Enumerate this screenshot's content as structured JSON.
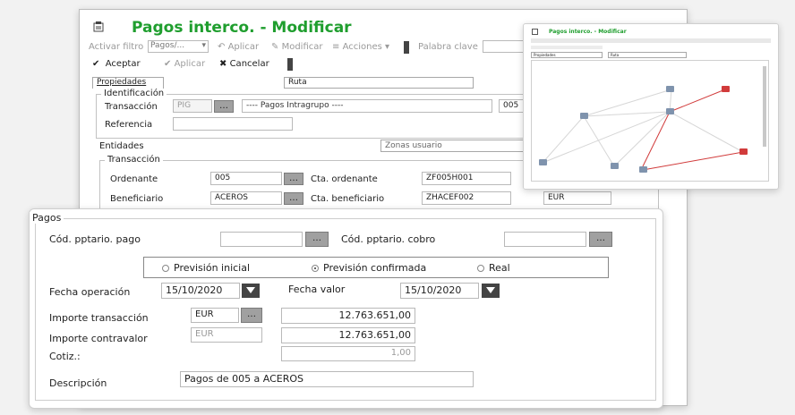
{
  "main": {
    "title": "Pagos interco. - Modificar",
    "toolbar": {
      "activar_filtro": "Activar filtro",
      "filtro_value": "Pagos/...",
      "aplicar": "Aplicar",
      "modificar": "Modificar",
      "acciones": "Acciones",
      "palabra_clave": "Palabra clave"
    },
    "actions": {
      "aceptar": "Aceptar",
      "aplicar": "Aplicar",
      "cancelar": "Cancelar"
    },
    "tabs": {
      "propiedades": "Propiedades",
      "ruta": "Ruta"
    },
    "identificacion": {
      "legend": "Identificación",
      "transaccion_label": "Transacción",
      "transaccion_code": "PIG",
      "transaccion_desc": "---- Pagos Intragrupo ----",
      "transaccion_extra": "005",
      "referencia_label": "Referencia",
      "referencia_value": ""
    },
    "entidades": {
      "tab_entidades": "Entidades",
      "tab_zonas": "Zonas usuario",
      "legend": "Transacción",
      "ordenante_label": "Ordenante",
      "ordenante_value": "005",
      "cta_ordenante_label": "Cta. ordenante",
      "cta_ordenante_value": "ZF005H001",
      "beneficiario_label": "Beneficiario",
      "beneficiario_value": "ACEROS",
      "cta_beneficiario_label": "Cta. beneficiario",
      "cta_beneficiario_value": "ZHACEF002",
      "currency": "EUR"
    }
  },
  "pagos": {
    "legend": "Pagos",
    "cod_pago_label": "Cód. pptario. pago",
    "cod_pago_value": "",
    "cod_cobro_label": "Cód. pptario. cobro",
    "cod_cobro_value": "",
    "radio": {
      "prevision_inicial": "Previsión inicial",
      "prevision_confirmada": "Previsión confirmada",
      "real": "Real",
      "selected": "prevision_confirmada"
    },
    "fecha_operacion_label": "Fecha operación",
    "fecha_operacion_value": "15/10/2020",
    "fecha_valor_label": "Fecha valor",
    "fecha_valor_value": "15/10/2020",
    "importe_transaccion_label": "Importe transacción",
    "importe_transaccion_currency": "EUR",
    "importe_transaccion_value": "12.763.651,00",
    "importe_contravalor_label": "Importe contravalor",
    "importe_contravalor_currency": "EUR",
    "importe_contravalor_value": "12.763.651,00",
    "cotiz_label": "Cotiz.:",
    "cotiz_value": "1,00",
    "descripcion_label": "Descripción",
    "descripcion_value": "Pagos de 005 a ACEROS"
  },
  "thumbnail": {
    "title": "Pagos interco. - Modificar",
    "tab_left": "Propiedades",
    "tab_right": "Ruta"
  },
  "colors": {
    "accent_green": "#1f9e2e",
    "route_red": "#d13b3b",
    "node_blue": "#7f93ad"
  }
}
